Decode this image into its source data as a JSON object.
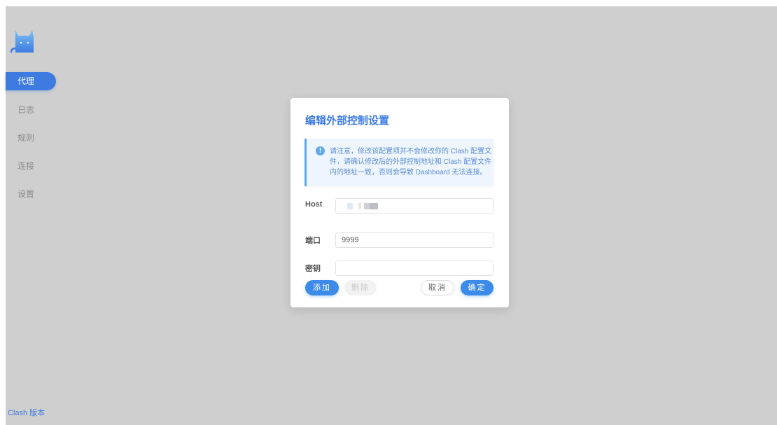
{
  "sidebar": {
    "logo": "cat-logo-icon",
    "items": [
      {
        "label": "代理",
        "active": true
      },
      {
        "label": "日志",
        "active": false
      },
      {
        "label": "规则",
        "active": false
      },
      {
        "label": "连接",
        "active": false
      },
      {
        "label": "设置",
        "active": false
      }
    ],
    "version_label": "Clash 版本"
  },
  "dialog": {
    "title": "编辑外部控制设置",
    "alert": {
      "icon": "info-icon",
      "icon_glyph": "!",
      "text": "请注意，修改该配置项并不会修改你的 Clash 配置文件，请确认修改后的外部控制地址和 Clash 配置文件内的地址一致，否则会导致 Dashboard 无法连接。"
    },
    "fields": {
      "host": {
        "label": "Host",
        "value": ""
      },
      "port": {
        "label": "端口",
        "value": "9999"
      },
      "secret": {
        "label": "密钥",
        "value": ""
      }
    },
    "buttons": {
      "add": "添加",
      "delete": "删除",
      "cancel": "取消",
      "confirm": "确定"
    }
  },
  "colors": {
    "accent": "#3d7be0",
    "overlay": "#cfcfcf",
    "alert_bg": "#eef5fd",
    "alert_border": "#5fa8ee"
  }
}
